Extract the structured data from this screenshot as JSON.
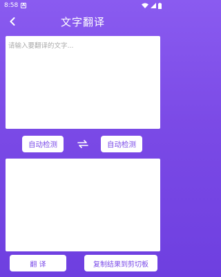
{
  "status_bar": {
    "time": "8:58",
    "notification_icon": "A"
  },
  "header": {
    "title": "文字翻译"
  },
  "input": {
    "placeholder": "请输入要翻译的文字...",
    "value": ""
  },
  "languages": {
    "source": "自动检测",
    "target": "自动检测"
  },
  "output": {
    "text": ""
  },
  "actions": {
    "translate_label": "翻 译",
    "copy_label": "复制结果到剪切板"
  },
  "colors": {
    "accent": "#7a4be8",
    "background_top": "#8a5bf0",
    "background_bottom": "#6e3fe0"
  },
  "icons": {
    "back": "chevron-left-icon",
    "swap": "swap-arrows-icon",
    "wifi": "wifi-icon",
    "signal": "signal-icon",
    "battery": "battery-icon"
  }
}
